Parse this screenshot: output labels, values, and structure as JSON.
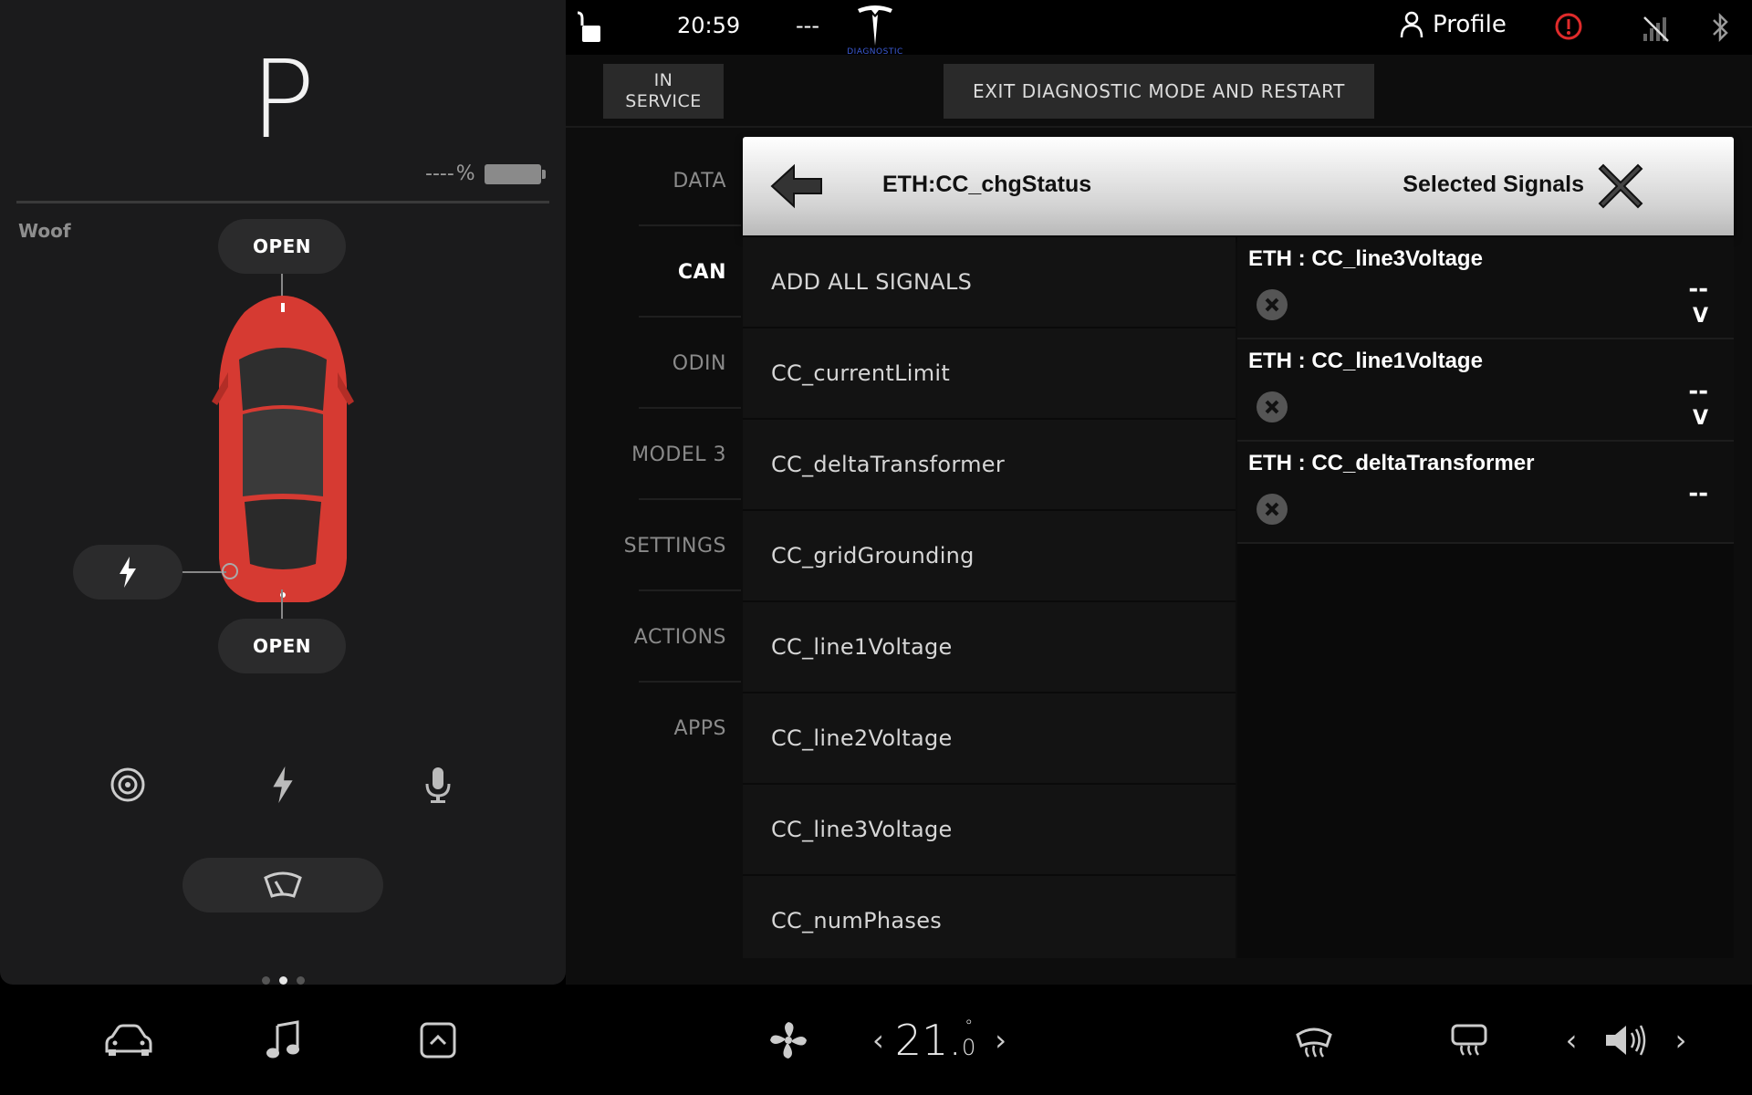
{
  "status_bar": {
    "time": "20:59",
    "outside_temp": "---",
    "logo_sub": "DIAGNOSTIC",
    "profile_label": "Profile"
  },
  "vehicle": {
    "gear": "P",
    "battery_percent": "----",
    "battery_unit": "%",
    "name": "Woof",
    "frunk_label": "OPEN",
    "trunk_label": "OPEN",
    "car_color": "#d63a32"
  },
  "service": {
    "status_label_1": "IN",
    "status_label_2": "SERVICE",
    "exit_button": "EXIT DIAGNOSTIC MODE AND RESTART"
  },
  "nav": {
    "items": [
      "DATA",
      "CAN",
      "ODIN",
      "MODEL 3",
      "SETTINGS",
      "ACTIONS",
      "APPS"
    ],
    "active": "CAN"
  },
  "dialog": {
    "title": "ETH:CC_chgStatus",
    "selected_header": "Selected Signals",
    "signals": [
      "ADD ALL SIGNALS",
      "CC_currentLimit",
      "CC_deltaTransformer",
      "CC_gridGrounding",
      "CC_line1Voltage",
      "CC_line2Voltage",
      "CC_line3Voltage",
      "CC_numPhases"
    ],
    "selected": [
      {
        "name": "ETH : CC_line3Voltage",
        "value": "--",
        "unit": "V"
      },
      {
        "name": "ETH : CC_line1Voltage",
        "value": "--",
        "unit": "V"
      },
      {
        "name": "ETH : CC_deltaTransformer",
        "value": "--",
        "unit": ""
      }
    ]
  },
  "climate": {
    "temperature": "21.",
    "temperature_decimal": "0",
    "temp_unit_symbol": "°"
  },
  "icons": {
    "lock": "unlock-icon",
    "alert_color": "#e02b2b",
    "accent": "#3c5bd6"
  }
}
